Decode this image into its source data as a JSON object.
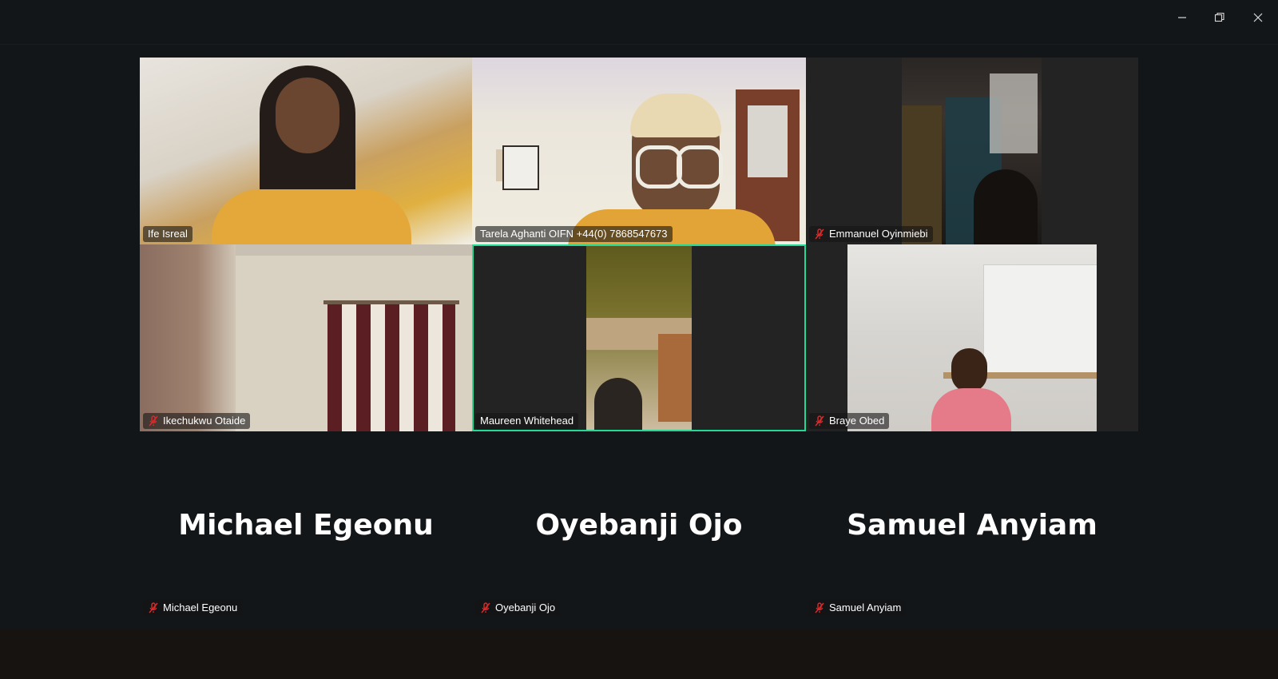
{
  "window": {
    "controls": {
      "minimize": "minimize-icon",
      "restore": "restore-icon",
      "close": "close-icon"
    }
  },
  "participants": [
    {
      "name": "Ife Isreal",
      "muted": false,
      "video": true
    },
    {
      "name": "Tarela Aghanti OIFN +44(0) 7868547673",
      "muted": false,
      "video": true
    },
    {
      "name": "Emmanuel Oyinmiebi",
      "muted": true,
      "video": true
    },
    {
      "name": "Ikechukwu Otaide",
      "muted": true,
      "video": true
    },
    {
      "name": "Maureen Whitehead",
      "muted": false,
      "video": true,
      "active_speaker": true
    },
    {
      "name": "Braye Obed",
      "muted": true,
      "video": true
    },
    {
      "name": "Michael Egeonu",
      "muted": true,
      "video": false,
      "display_name": "Michael Egeonu"
    },
    {
      "name": "Oyebanji Ojo",
      "muted": true,
      "video": false,
      "display_name": "Oyebanji Ojo"
    },
    {
      "name": "Samuel Anyiam",
      "muted": true,
      "video": false,
      "display_name": "Samuel Anyiam"
    }
  ],
  "colors": {
    "background": "#131619",
    "active_speaker_border": "#23d996",
    "muted_icon": "#e02828",
    "tile_bg": "#232323"
  }
}
